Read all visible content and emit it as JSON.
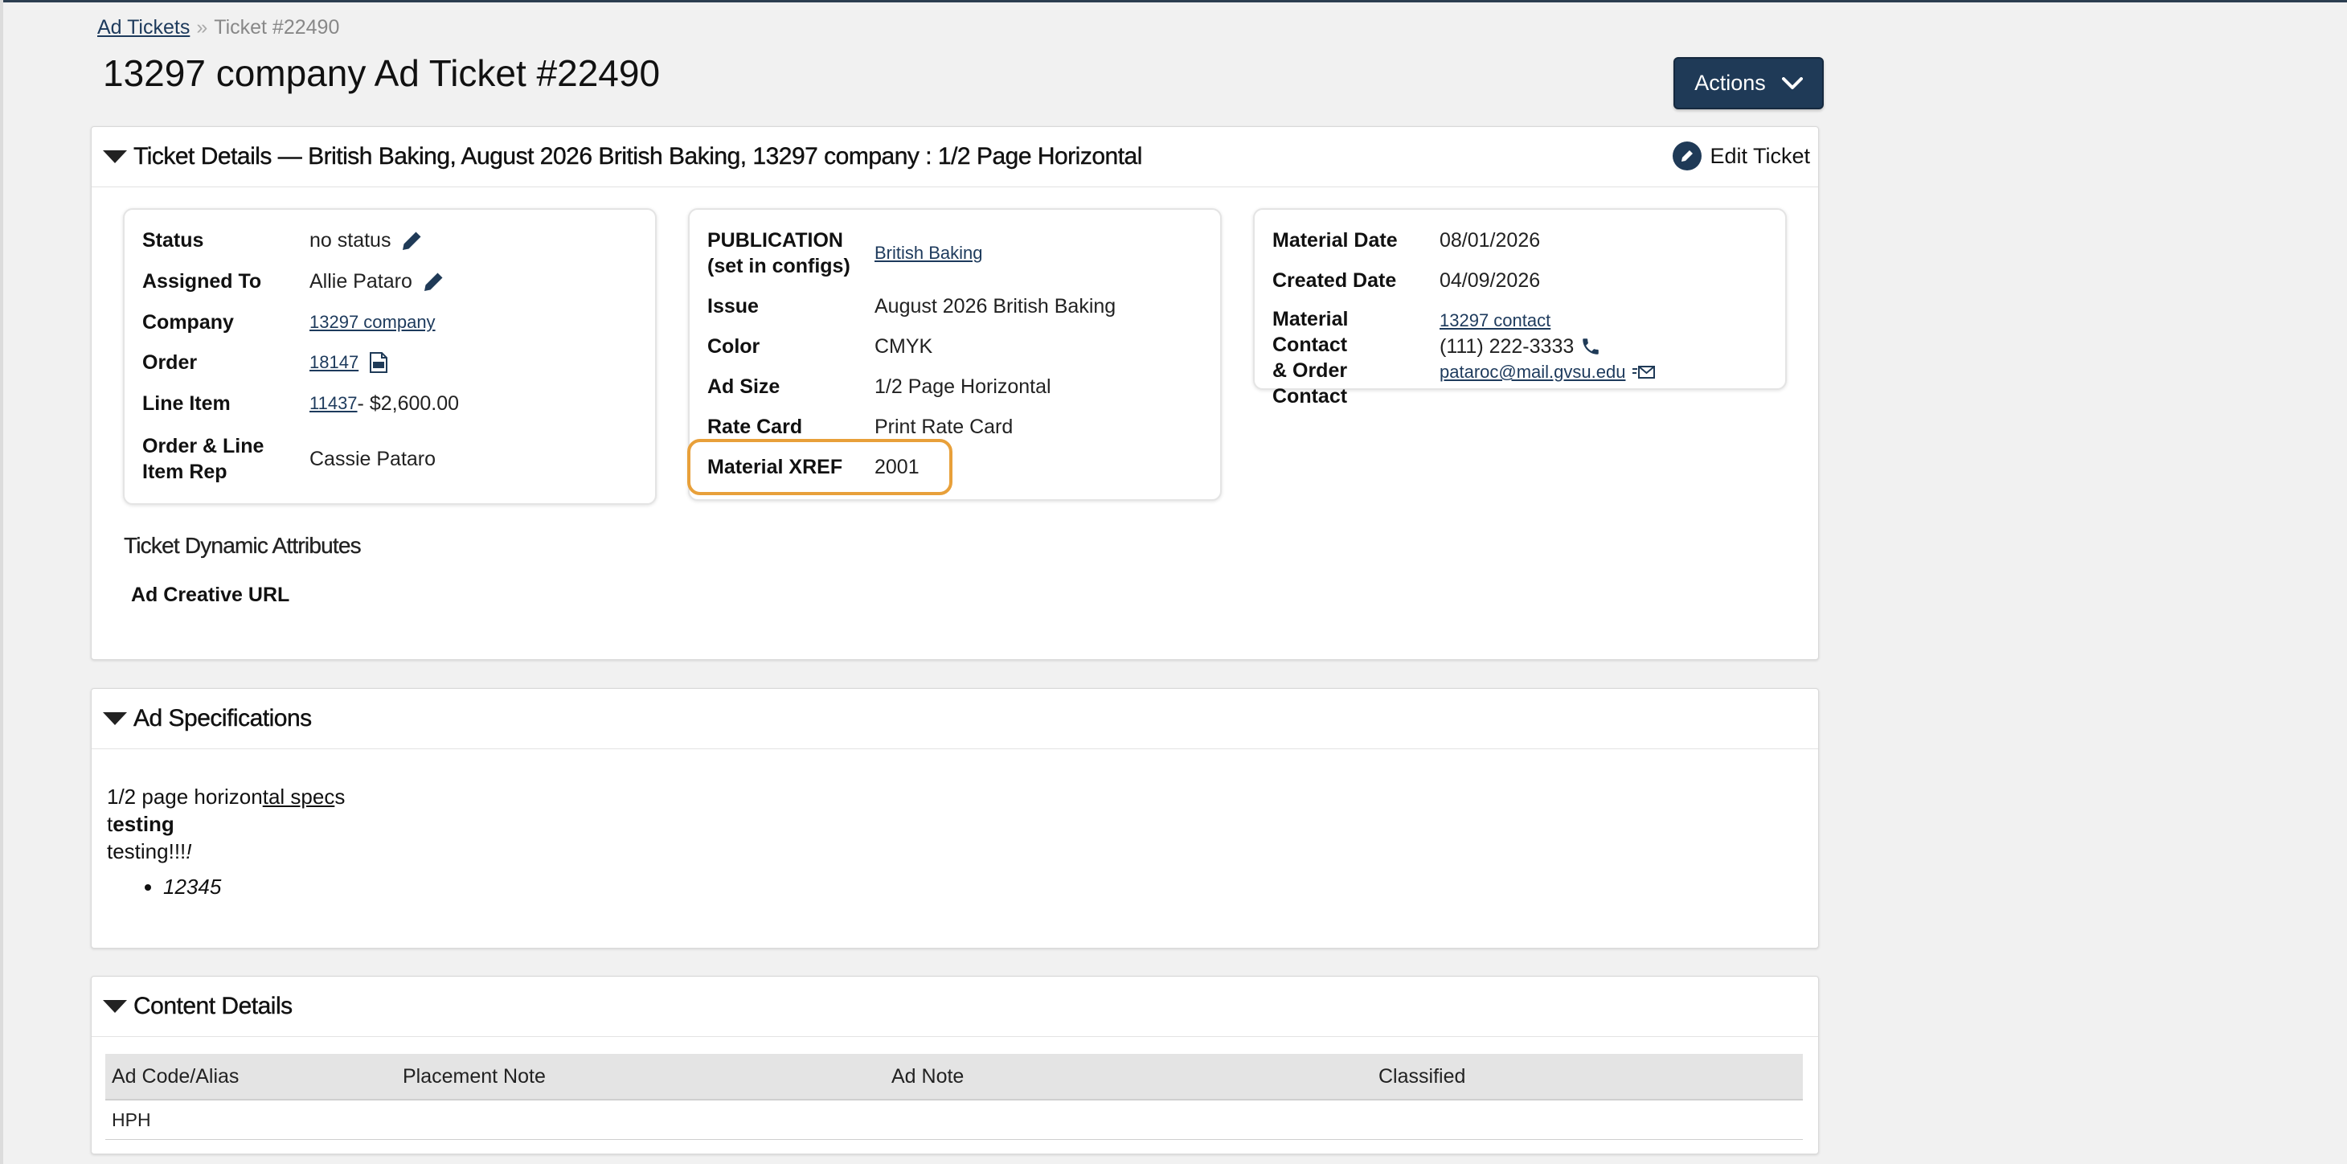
{
  "breadcrumb": {
    "root": "Ad Tickets",
    "separator": "»",
    "current": "Ticket #22490"
  },
  "page_title": "13297 company Ad Ticket #22490",
  "actions_label": "Actions",
  "ticket_details": {
    "title": "Ticket Details — British Baking, August 2026 British Baking, 13297 company : 1/2 Page Horizontal",
    "edit_label": "Edit Ticket",
    "card1": {
      "status_label": "Status",
      "status_value": "no status",
      "assigned_label": "Assigned To",
      "assigned_value": "Allie Pataro",
      "company_label": "Company",
      "company_value": "13297 company",
      "order_label": "Order",
      "order_value": "18147",
      "line_item_label": "Line Item",
      "line_item_link": "11437",
      "line_item_suffix": " - $2,600.00",
      "rep_label_1": "Order & Line",
      "rep_label_2": "Item Rep",
      "rep_value": "Cassie Pataro"
    },
    "card2": {
      "publication_label_1": "PUBLICATION",
      "publication_label_2": "(set in configs)",
      "publication_value": "British Baking",
      "issue_label": "Issue",
      "issue_value": "August 2026 British Baking",
      "color_label": "Color",
      "color_value": "CMYK",
      "ad_size_label": "Ad Size",
      "ad_size_value": "1/2 Page Horizontal",
      "rate_card_label": "Rate Card",
      "rate_card_value": "Print Rate Card",
      "xref_label": "Material XREF",
      "xref_value": "2001"
    },
    "card3": {
      "material_date_label": "Material Date",
      "material_date_value": "08/01/2026",
      "created_date_label": "Created Date",
      "created_date_value": "04/09/2026",
      "contact_label_1": "Material",
      "contact_label_2": "Contact",
      "contact_label_3": "& Order",
      "contact_label_4": "Contact",
      "contact_name": "13297 contact",
      "contact_phone": "(111) 222-3333",
      "contact_email": "pataroc@mail.gvsu.edu"
    },
    "dynamic_attributes_heading": "Ticket Dynamic Attributes",
    "ad_creative_url_label": "Ad Creative URL"
  },
  "ad_specs": {
    "title": "Ad Specifications",
    "line1_a": "1/2 page horizon",
    "line1_b": "tal spec",
    "line1_c": "s",
    "line2_a": "t",
    "line2_b": "esting",
    "line3_a": "testing!!!",
    "line3_b": "!",
    "bullet": "12345"
  },
  "content_details": {
    "title": "Content Details",
    "columns": [
      "Ad Code/Alias",
      "Placement Note",
      "Ad Note",
      "Classified"
    ],
    "rows": [
      [
        "HPH",
        "",
        "",
        ""
      ]
    ]
  },
  "colors": {
    "primary": "#1f3a57",
    "highlight": "#e8a03a",
    "link": "#1d3a5c"
  },
  "icons": [
    "pencil-icon",
    "pdf-icon",
    "phone-icon",
    "email-icon",
    "chevron-down-icon",
    "caret-down-icon"
  ]
}
